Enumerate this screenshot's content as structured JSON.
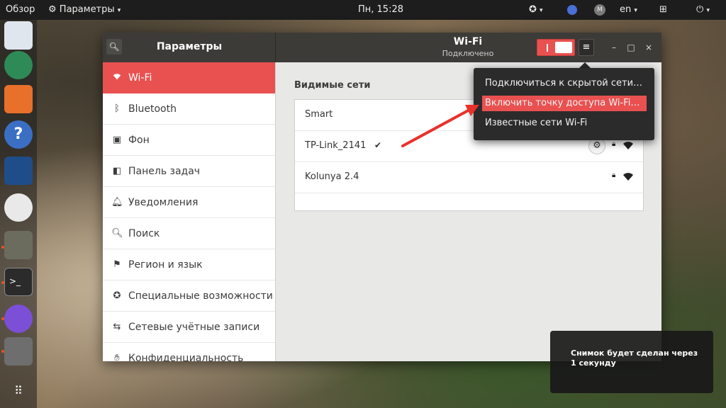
{
  "topbar": {
    "activities": "Обзор",
    "app_menu": "Параметры",
    "clock": "Пн, 15:28",
    "keyboard_layout": "en",
    "icons": [
      "gear-icon",
      "accessibility-icon",
      "messenger-icon",
      "mail-badge-icon",
      "network-icon",
      "power-icon",
      "chevron-down-icon"
    ]
  },
  "dock": {
    "items": [
      "notes-app-icon",
      "atom-icon",
      "software-center-icon",
      "help-icon",
      "system-monitor-icon",
      "easy-egg-icon",
      "gimp-icon",
      "terminal-icon",
      "viber-icon",
      "settings-tools-icon",
      "app-grid-icon"
    ]
  },
  "window": {
    "app_title": "Параметры",
    "page_title": "Wi-Fi",
    "page_subtitle": "Подключено",
    "wifi_enabled": true,
    "controls": {
      "minimize": "–",
      "maximize": "□",
      "close": "×"
    }
  },
  "sidebar": {
    "items": [
      {
        "label": "Wi-Fi",
        "icon": "wifi-icon",
        "active": true
      },
      {
        "label": "Bluetooth",
        "icon": "bluetooth-icon",
        "active": false
      },
      {
        "label": "Фон",
        "icon": "background-icon",
        "active": false
      },
      {
        "label": "Панель задач",
        "icon": "dock-icon",
        "active": false
      },
      {
        "label": "Уведомления",
        "icon": "bell-icon",
        "active": false
      },
      {
        "label": "Поиск",
        "icon": "search-icon",
        "active": false
      },
      {
        "label": "Регион и язык",
        "icon": "region-icon",
        "active": false
      },
      {
        "label": "Специальные возможности",
        "icon": "accessibility-icon",
        "active": false
      },
      {
        "label": "Сетевые учётные записи",
        "icon": "online-accounts-icon",
        "active": false
      },
      {
        "label": "Конфиденциальность",
        "icon": "hand-icon",
        "active": false
      }
    ]
  },
  "main": {
    "section_title": "Видимые сети",
    "networks": [
      {
        "name": "Smart",
        "connected": false,
        "secured": false
      },
      {
        "name": "TP-Link_2141",
        "connected": true,
        "check": "✔",
        "secured": true
      },
      {
        "name": "Kolunya 2.4",
        "connected": false,
        "secured": true
      }
    ]
  },
  "menu": {
    "items": [
      {
        "label": "Подключиться к скрытой сети…",
        "highlighted": false
      },
      {
        "label": "Включить точку доступа Wi-Fi…",
        "highlighted": true
      },
      {
        "label": "Известные сети Wi-Fi",
        "highlighted": false
      }
    ]
  },
  "notification": {
    "text": "Снимок будет сделан через 1 секунду"
  },
  "colors": {
    "accent": "#e95151",
    "titlebar": "#3c3b37",
    "topbar": "#1d1d1d",
    "annotation_arrow": "#e8312a"
  }
}
